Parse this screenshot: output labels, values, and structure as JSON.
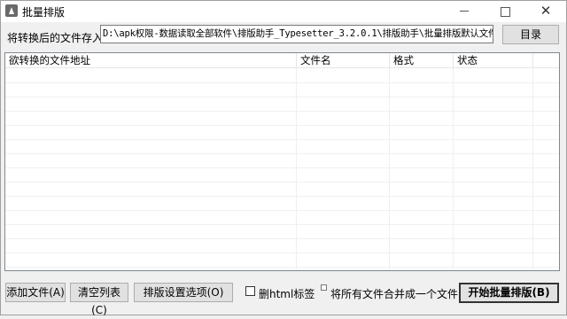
{
  "window": {
    "title": "批量排版",
    "minimize_symbol": "",
    "maximize_symbol": "",
    "close_symbol": "✕"
  },
  "output": {
    "label": "将转换后的文件存入",
    "path": "D:\\apk权限-数据读取全部软件\\排版助手_Typesetter_3.2.0.1\\排版助手\\批量排版默认文件夹",
    "browse_button": "目录"
  },
  "table": {
    "columns": [
      "欲转换的文件地址",
      "文件名",
      "格式",
      "状态"
    ],
    "rows": []
  },
  "actions": {
    "add_files": "添加文件(A)",
    "clear_list": "清空列表(C)",
    "options": "排版设置选项(O)",
    "delete_html_label": "删html标签",
    "merge_label": "将所有文件合并成一个文件",
    "start": "开始批量排版(B)",
    "delete_html_checked": false,
    "merge_checked": false
  }
}
